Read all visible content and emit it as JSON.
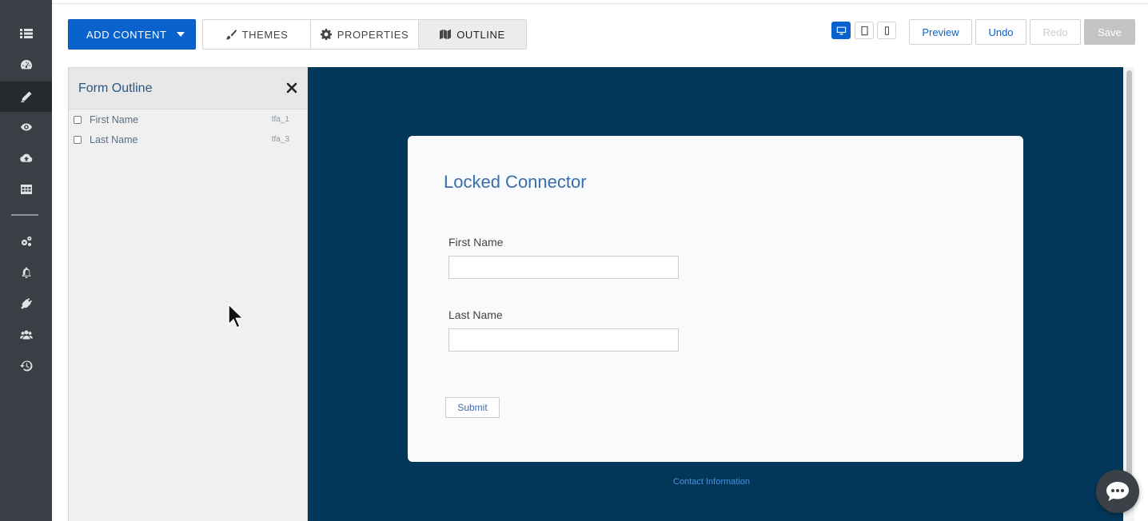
{
  "rail": {
    "items": [
      {
        "icon": "list-icon"
      },
      {
        "icon": "dashboard-icon"
      },
      {
        "icon": "pencil-icon",
        "active": true
      },
      {
        "icon": "eye-icon"
      },
      {
        "icon": "cloud-upload-icon"
      },
      {
        "icon": "table-icon"
      },
      {
        "icon": "gears-icon"
      },
      {
        "icon": "bell-icon"
      },
      {
        "icon": "plug-icon"
      },
      {
        "icon": "users-icon"
      },
      {
        "icon": "history-icon"
      }
    ]
  },
  "toolbar": {
    "add_content_label": "ADD CONTENT",
    "tabs": [
      {
        "label": "THEMES",
        "icon": "brush-icon"
      },
      {
        "label": "PROPERTIES",
        "icon": "gear-icon"
      },
      {
        "label": "OUTLINE",
        "icon": "map-icon",
        "active": true
      }
    ],
    "devices": [
      {
        "icon": "desktop-icon",
        "active": true
      },
      {
        "icon": "tablet-icon"
      },
      {
        "icon": "phone-icon"
      }
    ],
    "preview_label": "Preview",
    "undo_label": "Undo",
    "redo_label": "Redo",
    "save_label": "Save"
  },
  "outline": {
    "title": "Form Outline",
    "items": [
      {
        "label": "First Name",
        "id": "tfa_1"
      },
      {
        "label": "Last Name",
        "id": "tfa_3"
      }
    ]
  },
  "form": {
    "title": "Locked Connector",
    "fields": [
      {
        "label": "First Name",
        "value": ""
      },
      {
        "label": "Last Name",
        "value": ""
      }
    ],
    "submit_label": "Submit",
    "footer_link": "Contact Information"
  },
  "colors": {
    "accent": "#0a62cc",
    "canvas_bg": "#03375a",
    "rail_bg": "#393f45"
  }
}
